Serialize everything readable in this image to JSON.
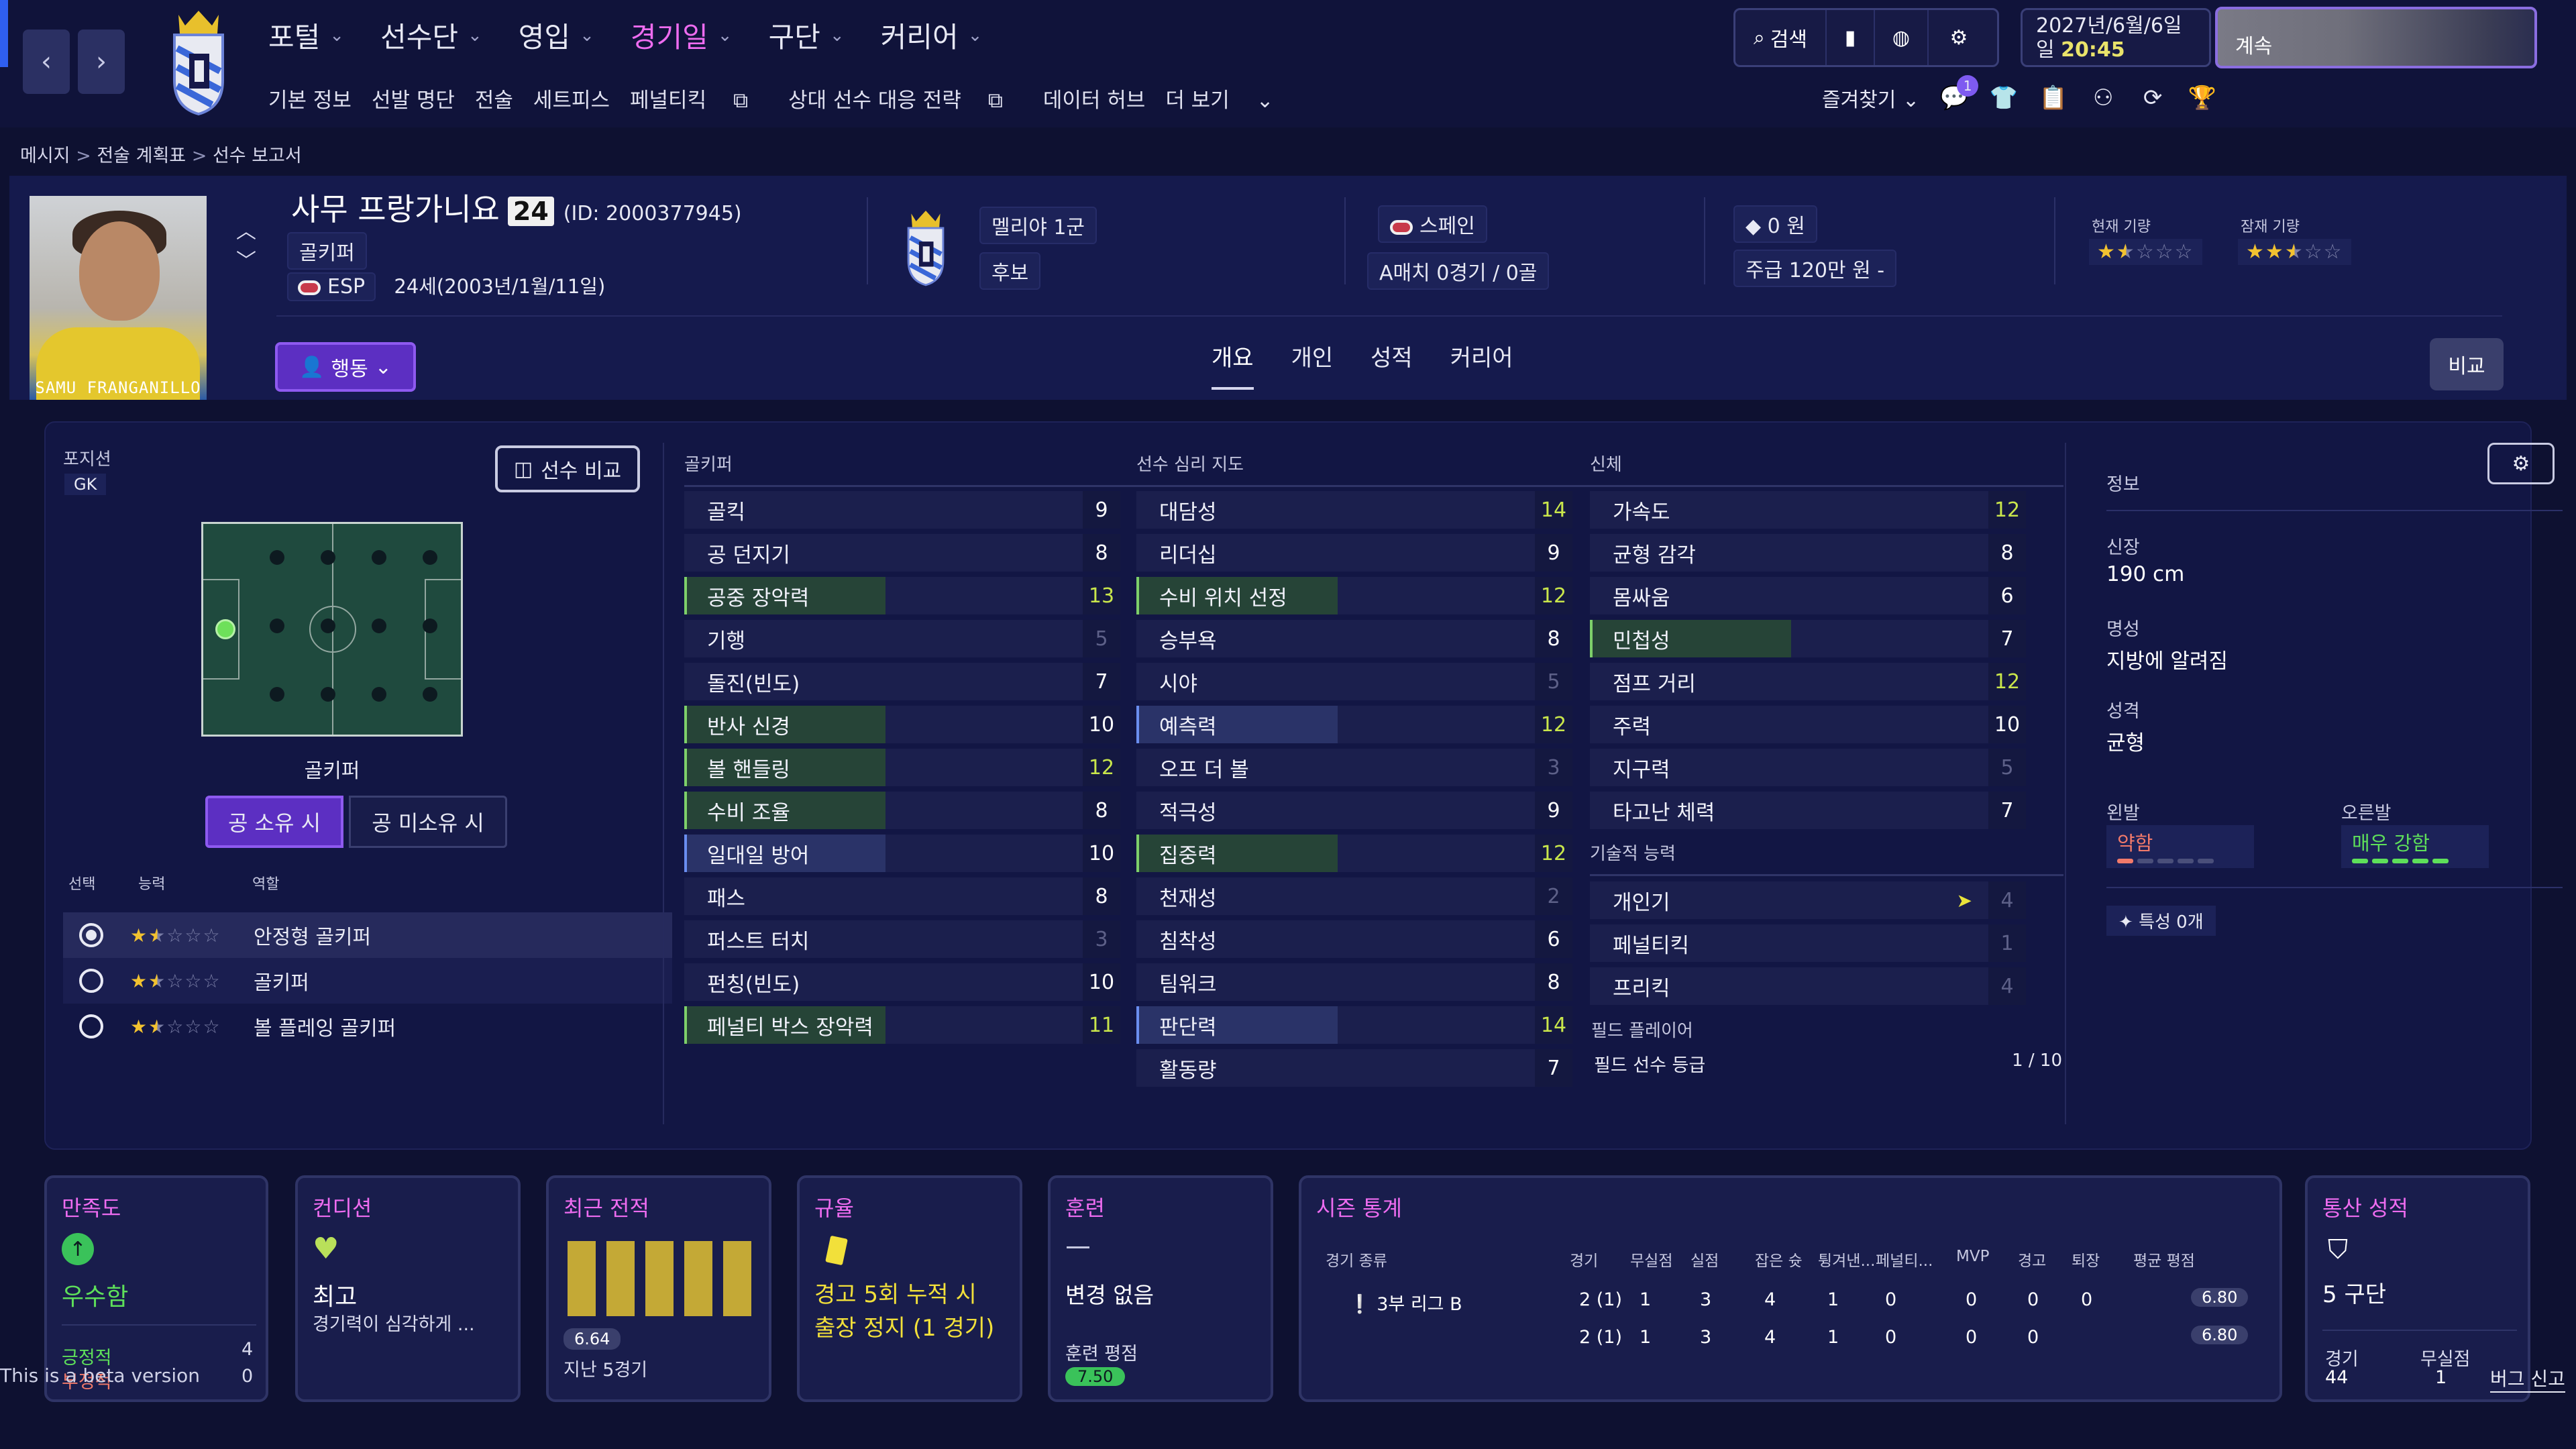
{
  "nav": {
    "menu": [
      {
        "label": "포털",
        "active": false
      },
      {
        "label": "선수단",
        "active": false
      },
      {
        "label": "영입",
        "active": false
      },
      {
        "label": "경기일",
        "active": true
      },
      {
        "label": "구단",
        "active": false
      },
      {
        "label": "커리어",
        "active": false
      }
    ],
    "submenu": [
      "기본 정보",
      "선발 명단",
      "전술",
      "세트피스",
      "페널티킥",
      "상대 선수 대응 전략",
      "데이터 허브",
      "더 보기"
    ],
    "search_label": "검색",
    "date_top": "2027년/6월/6일",
    "date_day": "일",
    "time": "20:45",
    "continue_label": "계속",
    "favorites_label": "즐겨찾기",
    "notification_count": "1"
  },
  "breadcrumb": [
    "메시지",
    "전술 계획표",
    "선수 보고서"
  ],
  "player": {
    "name": "사무 프랑가니요",
    "number": "24",
    "id_text": "(ID: 2000377945)",
    "position": "골키퍼",
    "nation_code": "ESP",
    "age_text": "24세(2003년/1월/11일)",
    "photo_caption": "SAMU FRANGANILLO",
    "club": "멜리야 1군",
    "squad_status": "후보",
    "nation": "스페인",
    "caps": "A매치 0경기 / 0골",
    "value": "0 원",
    "wage": "주급 120만 원 -",
    "current_ability_label": "현재 기량",
    "potential_ability_label": "잠재 기량",
    "current_ability_stars": 1.5,
    "potential_ability_stars": 2.5,
    "action_label": "행동",
    "compare_label": "비교",
    "tabs": [
      "개요",
      "개인",
      "성적",
      "커리어"
    ],
    "active_tab": "개요"
  },
  "position_panel": {
    "title": "포지션",
    "code": "GK",
    "compare_btn": "선수 비교",
    "position_name": "골키퍼",
    "in_possession": "공 소유 시",
    "out_possession": "공 미소유 시",
    "col_select": "선택",
    "col_ability": "능력",
    "col_role": "역할",
    "roles": [
      {
        "name": "안정형 골키퍼",
        "stars": 1.5,
        "selected": true
      },
      {
        "name": "골키퍼",
        "stars": 1.5,
        "selected": false
      },
      {
        "name": "볼 플레잉 골키퍼",
        "stars": 1.5,
        "selected": false
      }
    ]
  },
  "attributes": {
    "goalkeeper": {
      "title": "골키퍼",
      "items": [
        {
          "name": "골킥",
          "value": "9",
          "hl": false,
          "tone": "white"
        },
        {
          "name": "공 던지기",
          "value": "8",
          "hl": false,
          "tone": "white"
        },
        {
          "name": "공중 장악력",
          "value": "13",
          "hl": true,
          "tone": "green"
        },
        {
          "name": "기행",
          "value": "5",
          "hl": false,
          "tone": "grey"
        },
        {
          "name": "돌진(빈도)",
          "value": "7",
          "hl": false,
          "tone": "white"
        },
        {
          "name": "반사 신경",
          "value": "10",
          "hl": true,
          "tone": "white"
        },
        {
          "name": "볼 핸들링",
          "value": "12",
          "hl": true,
          "tone": "green"
        },
        {
          "name": "수비 조율",
          "value": "8",
          "hl": true,
          "tone": "white"
        },
        {
          "name": "일대일 방어",
          "value": "10",
          "hl": true,
          "tone": "white",
          "blue": true
        },
        {
          "name": "패스",
          "value": "8",
          "hl": false,
          "tone": "white"
        },
        {
          "name": "퍼스트 터치",
          "value": "3",
          "hl": false,
          "tone": "grey"
        },
        {
          "name": "펀칭(빈도)",
          "value": "10",
          "hl": false,
          "tone": "white"
        },
        {
          "name": "페널티 박스 장악력",
          "value": "11",
          "hl": true,
          "tone": "green"
        }
      ]
    },
    "mental": {
      "title": "선수 심리 지도",
      "items": [
        {
          "name": "대담성",
          "value": "14",
          "hl": false,
          "tone": "green"
        },
        {
          "name": "리더십",
          "value": "9",
          "hl": false,
          "tone": "white"
        },
        {
          "name": "수비 위치 선정",
          "value": "12",
          "hl": true,
          "tone": "green"
        },
        {
          "name": "승부욕",
          "value": "8",
          "hl": false,
          "tone": "white"
        },
        {
          "name": "시야",
          "value": "5",
          "hl": false,
          "tone": "grey"
        },
        {
          "name": "예측력",
          "value": "12",
          "hl": true,
          "tone": "green",
          "blue": true
        },
        {
          "name": "오프 더 볼",
          "value": "3",
          "hl": false,
          "tone": "grey"
        },
        {
          "name": "적극성",
          "value": "9",
          "hl": false,
          "tone": "white"
        },
        {
          "name": "집중력",
          "value": "12",
          "hl": true,
          "tone": "green"
        },
        {
          "name": "천재성",
          "value": "2",
          "hl": false,
          "tone": "grey"
        },
        {
          "name": "침착성",
          "value": "6",
          "hl": false,
          "tone": "white"
        },
        {
          "name": "팀워크",
          "value": "8",
          "hl": false,
          "tone": "white"
        },
        {
          "name": "판단력",
          "value": "14",
          "hl": true,
          "tone": "green",
          "blue": true
        },
        {
          "name": "활동량",
          "value": "7",
          "hl": false,
          "tone": "white"
        }
      ]
    },
    "physical": {
      "title": "신체",
      "items": [
        {
          "name": "가속도",
          "value": "12",
          "hl": false,
          "tone": "green"
        },
        {
          "name": "균형 감각",
          "value": "8",
          "hl": false,
          "tone": "white"
        },
        {
          "name": "몸싸움",
          "value": "6",
          "hl": false,
          "tone": "white"
        },
        {
          "name": "민첩성",
          "value": "7",
          "hl": true,
          "tone": "white"
        },
        {
          "name": "점프 거리",
          "value": "12",
          "hl": false,
          "tone": "green"
        },
        {
          "name": "주력",
          "value": "10",
          "hl": false,
          "tone": "white"
        },
        {
          "name": "지구력",
          "value": "5",
          "hl": false,
          "tone": "grey"
        },
        {
          "name": "타고난 체력",
          "value": "7",
          "hl": false,
          "tone": "white"
        }
      ]
    },
    "technical": {
      "title": "기술적 능력",
      "items": [
        {
          "name": "개인기",
          "value": "4",
          "hl": false,
          "tone": "grey",
          "arrow": true
        },
        {
          "name": "페널티킥",
          "value": "1",
          "hl": false,
          "tone": "grey"
        },
        {
          "name": "프리킥",
          "value": "4",
          "hl": false,
          "tone": "grey"
        }
      ]
    },
    "field_label": "필드 플레이어",
    "field_rank_label": "필드 선수 등급",
    "field_rank_value": "1 / 10"
  },
  "info": {
    "title": "정보",
    "height_label": "신장",
    "height": "190 cm",
    "fame_label": "명성",
    "fame": "지방에 알려짐",
    "personality_label": "성격",
    "personality": "균형",
    "left_foot_label": "왼발",
    "left_foot": "약함",
    "right_foot_label": "오른발",
    "right_foot": "매우 강함",
    "left_foot_level": 0.2,
    "right_foot_level": 1.0,
    "traits_label": "특성 0개"
  },
  "cards": {
    "morale": {
      "title": "만족도",
      "value": "우수함",
      "pos_label": "긍정적",
      "pos_value": "4",
      "neg_label": "부정적",
      "neg_value": "0",
      "overlay": "This is a beta version"
    },
    "condition": {
      "title": "컨디션",
      "value": "최고",
      "sub": "경기력이 심각하게 ..."
    },
    "form": {
      "title": "최근 전적",
      "rating": "6.64",
      "sub": "지난 5경기",
      "bars": [
        1,
        1,
        1,
        1,
        1
      ]
    },
    "discipline": {
      "title": "규율",
      "text1": "경고 5회 누적 시",
      "text2": "출장 정지 (1 경기)"
    },
    "training": {
      "title": "훈련",
      "value": "변경 없음",
      "rating_label": "훈련 평점",
      "rating": "7.50"
    },
    "season": {
      "title": "시즌 통계",
      "headers": [
        "경기 종류",
        "경기",
        "무실점",
        "실점",
        "잡은 슛",
        "튕겨낸...",
        "페널티...",
        "MVP",
        "경고",
        "퇴장",
        "평균 평점"
      ],
      "rows": [
        {
          "comp": "3부 리그 B",
          "cells": [
            "2 (1)",
            "1",
            "3",
            "4",
            "1",
            "0",
            "0",
            "0",
            "0"
          ],
          "rating": "6.80"
        },
        {
          "comp": "",
          "cells": [
            "2 (1)",
            "1",
            "3",
            "4",
            "1",
            "0",
            "0",
            "0",
            ""
          ],
          "rating": "6.80"
        }
      ]
    },
    "career": {
      "title": "통산 성적",
      "value": "5 구단",
      "apps_label": "경기",
      "apps": "44",
      "cs_label": "무실점",
      "cs": "1",
      "bug_label": "버그 신고"
    }
  },
  "colors": {
    "accent": "#ee6cf0",
    "green": "#c9e64b",
    "purple": "#5c2fc2",
    "star": "#f2c230"
  }
}
